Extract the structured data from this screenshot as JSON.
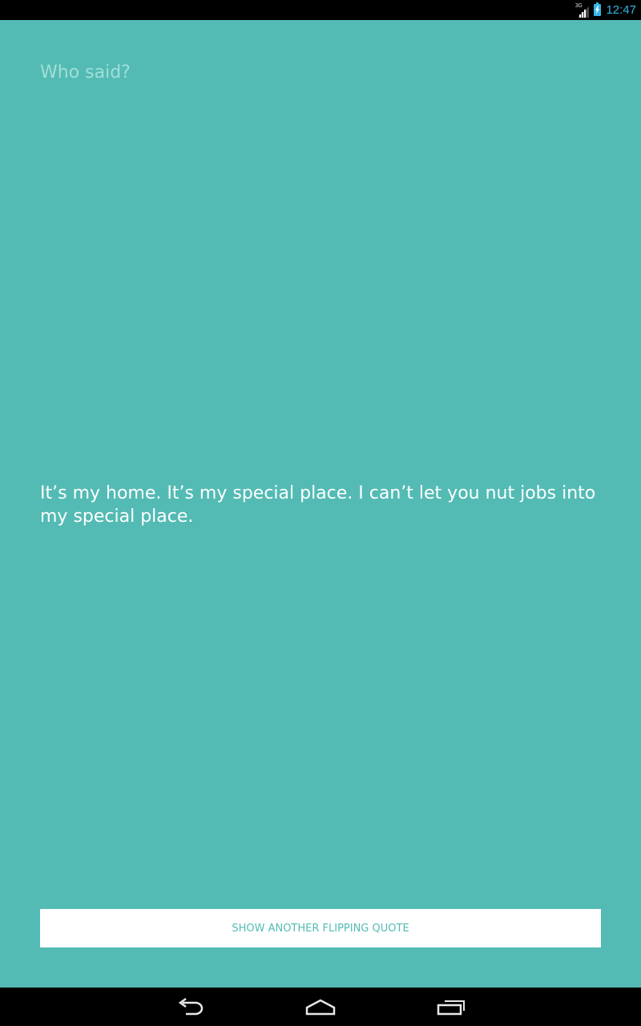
{
  "status_bar": {
    "network_type": "3G",
    "time": "12:47",
    "icons": [
      "signal-icon",
      "battery-charging-icon"
    ]
  },
  "header": {
    "title": "Who said?"
  },
  "quote": {
    "text": "It’s my home. It’s my special place.  I can’t let you nut jobs into my special place."
  },
  "action": {
    "button_label": "SHOW ANOTHER FLIPPING QUOTE"
  },
  "nav_bar": {
    "icons": [
      "back-icon",
      "home-icon",
      "recent-apps-icon"
    ]
  },
  "colors": {
    "background": "#53BBB4",
    "title_text": "#A3DED9",
    "quote_text": "#FFFFFF",
    "button_background": "#FFFFFF",
    "button_text": "#53BBB4",
    "status_accent": "#33B5E5"
  }
}
